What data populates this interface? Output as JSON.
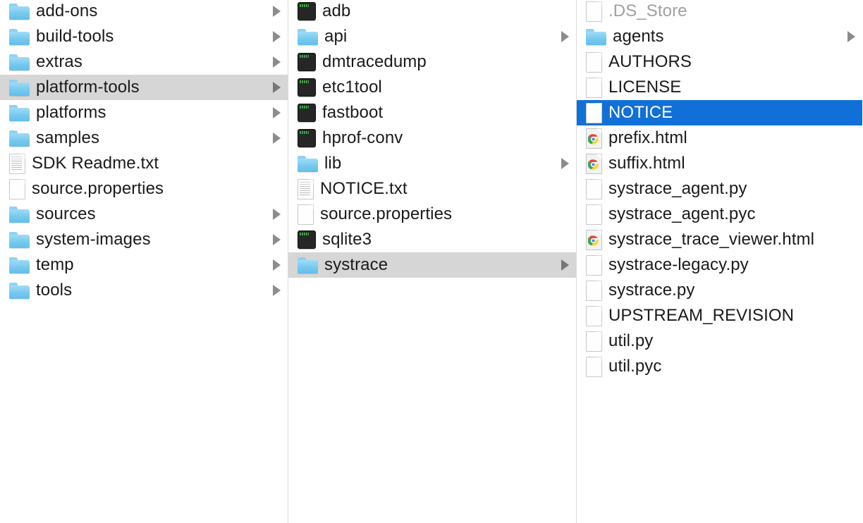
{
  "app": {
    "name": "Finder",
    "view": "column-view",
    "selection_color": "#1070d8",
    "highlight_color": "#d6d6d6",
    "folder_color": "#76c8ee"
  },
  "columns": [
    {
      "name": "sdk-column",
      "items": [
        {
          "label": "add-ons",
          "icon": "folder",
          "chevron": true,
          "state": "normal"
        },
        {
          "label": "build-tools",
          "icon": "folder",
          "chevron": true,
          "state": "normal"
        },
        {
          "label": "extras",
          "icon": "folder",
          "chevron": true,
          "state": "normal"
        },
        {
          "label": "platform-tools",
          "icon": "folder",
          "chevron": true,
          "state": "highlighted"
        },
        {
          "label": "platforms",
          "icon": "folder",
          "chevron": true,
          "state": "normal"
        },
        {
          "label": "samples",
          "icon": "folder",
          "chevron": true,
          "state": "normal"
        },
        {
          "label": "SDK Readme.txt",
          "icon": "text-document",
          "chevron": false,
          "state": "normal"
        },
        {
          "label": "source.properties",
          "icon": "document",
          "chevron": false,
          "state": "normal"
        },
        {
          "label": "sources",
          "icon": "folder",
          "chevron": true,
          "state": "normal"
        },
        {
          "label": "system-images",
          "icon": "folder",
          "chevron": true,
          "state": "normal"
        },
        {
          "label": "temp",
          "icon": "folder",
          "chevron": true,
          "state": "normal"
        },
        {
          "label": "tools",
          "icon": "folder",
          "chevron": true,
          "state": "normal"
        }
      ]
    },
    {
      "name": "platform-tools-column",
      "items": [
        {
          "label": "adb",
          "icon": "executable",
          "chevron": false,
          "state": "normal"
        },
        {
          "label": "api",
          "icon": "folder",
          "chevron": true,
          "state": "normal"
        },
        {
          "label": "dmtracedump",
          "icon": "executable",
          "chevron": false,
          "state": "normal"
        },
        {
          "label": "etc1tool",
          "icon": "executable",
          "chevron": false,
          "state": "normal"
        },
        {
          "label": "fastboot",
          "icon": "executable",
          "chevron": false,
          "state": "normal"
        },
        {
          "label": "hprof-conv",
          "icon": "executable",
          "chevron": false,
          "state": "normal"
        },
        {
          "label": "lib",
          "icon": "folder",
          "chevron": true,
          "state": "normal"
        },
        {
          "label": "NOTICE.txt",
          "icon": "text-document",
          "chevron": false,
          "state": "normal"
        },
        {
          "label": "source.properties",
          "icon": "document",
          "chevron": false,
          "state": "normal"
        },
        {
          "label": "sqlite3",
          "icon": "executable",
          "chevron": false,
          "state": "normal"
        },
        {
          "label": "systrace",
          "icon": "folder",
          "chevron": true,
          "state": "highlighted"
        }
      ]
    },
    {
      "name": "systrace-column",
      "items": [
        {
          "label": ".DS_Store",
          "icon": "document",
          "chevron": false,
          "state": "dimmed"
        },
        {
          "label": "agents",
          "icon": "folder",
          "chevron": true,
          "state": "normal"
        },
        {
          "label": "AUTHORS",
          "icon": "document",
          "chevron": false,
          "state": "normal"
        },
        {
          "label": "LICENSE",
          "icon": "document",
          "chevron": false,
          "state": "normal"
        },
        {
          "label": "NOTICE",
          "icon": "document",
          "chevron": false,
          "state": "selected"
        },
        {
          "label": "prefix.html",
          "icon": "chrome-html",
          "chevron": false,
          "state": "normal"
        },
        {
          "label": "suffix.html",
          "icon": "chrome-html",
          "chevron": false,
          "state": "normal"
        },
        {
          "label": "systrace_agent.py",
          "icon": "document",
          "chevron": false,
          "state": "normal"
        },
        {
          "label": "systrace_agent.pyc",
          "icon": "document",
          "chevron": false,
          "state": "normal"
        },
        {
          "label": "systrace_trace_viewer.html",
          "icon": "chrome-html",
          "chevron": false,
          "state": "normal"
        },
        {
          "label": "systrace-legacy.py",
          "icon": "document",
          "chevron": false,
          "state": "normal"
        },
        {
          "label": "systrace.py",
          "icon": "document",
          "chevron": false,
          "state": "normal"
        },
        {
          "label": "UPSTREAM_REVISION",
          "icon": "document",
          "chevron": false,
          "state": "normal"
        },
        {
          "label": "util.py",
          "icon": "document",
          "chevron": false,
          "state": "normal"
        },
        {
          "label": "util.pyc",
          "icon": "document",
          "chevron": false,
          "state": "normal"
        }
      ]
    }
  ]
}
